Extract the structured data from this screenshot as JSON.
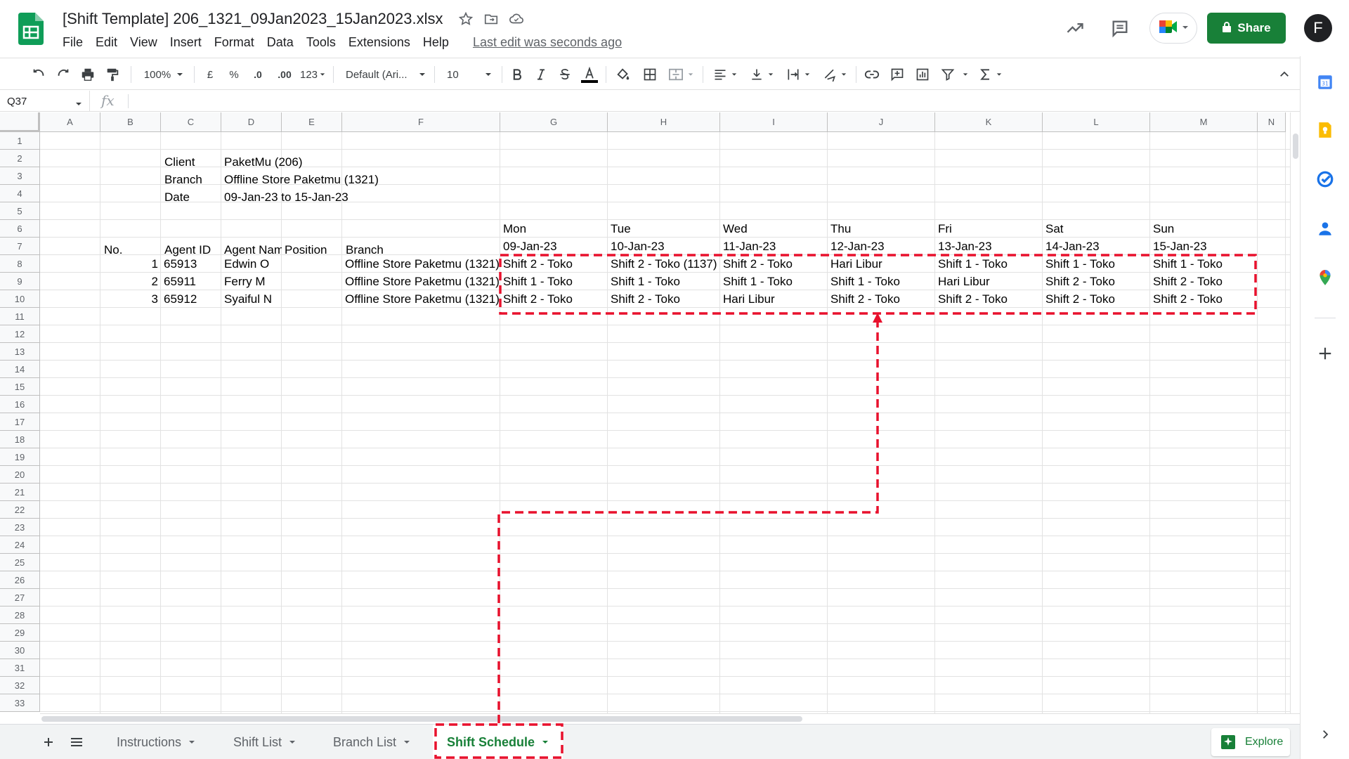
{
  "title_bar": {
    "doc_title": "[Shift Template] 206_1321_09Jan2023_15Jan2023.xlsx",
    "menu": [
      "File",
      "Edit",
      "View",
      "Insert",
      "Format",
      "Data",
      "Tools",
      "Extensions",
      "Help"
    ],
    "last_edit": "Last edit was seconds ago",
    "share_label": "Share",
    "avatar_letter": "F"
  },
  "toolbar": {
    "zoom": "100%",
    "currency": "£",
    "percent": "%",
    "dec_decrease": ".0",
    "dec_increase": ".00",
    "more_formats": "123",
    "font": "Default (Ari...",
    "font_size": "10"
  },
  "formula_bar": {
    "cell_ref": "Q37",
    "fx": "fx",
    "value": ""
  },
  "columns": [
    "A",
    "B",
    "C",
    "D",
    "E",
    "F",
    "G",
    "H",
    "I",
    "J",
    "K",
    "L",
    "M",
    "N"
  ],
  "rows": [
    "1",
    "2",
    "3",
    "4",
    "5",
    "6",
    "7",
    "8",
    "9",
    "10",
    "11",
    "12",
    "13",
    "14",
    "15",
    "16",
    "17",
    "18",
    "19",
    "20",
    "21",
    "22",
    "23",
    "24",
    "25",
    "26",
    "27",
    "28",
    "29",
    "30",
    "31",
    "32",
    "33"
  ],
  "sheet": {
    "header_info": [
      {
        "label": "Client",
        "value": "PaketMu (206)"
      },
      {
        "label": "Branch",
        "value": "Offline Store Paketmu (1321)"
      },
      {
        "label": "Date",
        "value": "09-Jan-23 to 15-Jan-23"
      }
    ],
    "days": [
      "Mon",
      "Tue",
      "Wed",
      "Thu",
      "Fri",
      "Sat",
      "Sun"
    ],
    "dates": [
      "09-Jan-23",
      "10-Jan-23",
      "11-Jan-23",
      "12-Jan-23",
      "13-Jan-23",
      "14-Jan-23",
      "15-Jan-23"
    ],
    "table_headers": [
      "No.",
      "Agent ID",
      "Agent Nam",
      "Position",
      "Branch"
    ],
    "agents": [
      {
        "no": "1",
        "id": "65913",
        "name": "Edwin O",
        "position": "",
        "branch": "Offline Store Paketmu (1321)",
        "shifts": [
          "Shift 2 - Toko",
          "Shift 2 - Toko (1137)",
          "Shift 2 - Toko",
          "Hari Libur",
          "Shift 1 - Toko",
          "Shift 1 - Toko",
          "Shift 1 - Toko"
        ]
      },
      {
        "no": "2",
        "id": "65911",
        "name": "Ferry M",
        "position": "",
        "branch": "Offline Store Paketmu (1321)",
        "shifts": [
          "Shift 1 - Toko",
          "Shift 1 - Toko",
          "Shift 1 - Toko",
          "Shift 1 - Toko",
          "Hari Libur",
          "Shift 2 - Toko",
          "Shift 2 - Toko"
        ]
      },
      {
        "no": "3",
        "id": "65912",
        "name": "Syaiful N",
        "position": "",
        "branch": "Offline Store Paketmu (1321)",
        "shifts": [
          "Shift 2 - Toko",
          "Shift 2 - Toko",
          "Hari Libur",
          "Shift 2 - Toko",
          "Shift 2 - Toko",
          "Shift 2 - Toko",
          "Shift 2 - Toko"
        ]
      }
    ]
  },
  "tabs": [
    {
      "label": "Instructions",
      "active": false
    },
    {
      "label": "Shift List",
      "active": false
    },
    {
      "label": "Branch List",
      "active": false
    },
    {
      "label": "Shift Schedule",
      "active": true
    }
  ],
  "explore_label": "Explore",
  "colors": {
    "brand_green": "#188038",
    "annotation_red": "#e8112d"
  }
}
